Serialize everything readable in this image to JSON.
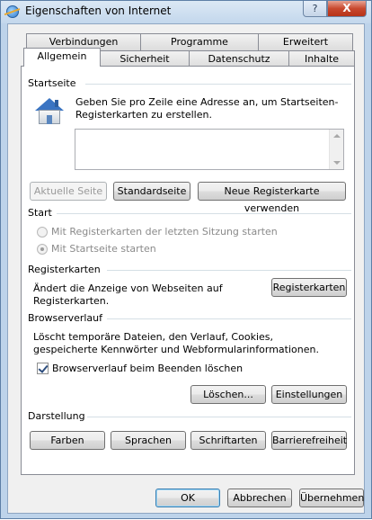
{
  "window": {
    "title": "Eigenschaften von Internet",
    "help_label": "?",
    "close_label": "X",
    "icon": "internet-options-icon"
  },
  "tabs": {
    "row1": [
      "Verbindungen",
      "Programme",
      "Erweitert"
    ],
    "row2": [
      "Allgemein",
      "Sicherheit",
      "Datenschutz",
      "Inhalte"
    ],
    "active": "Allgemein"
  },
  "startseite": {
    "title": "Startseite",
    "description": "Geben Sie pro Zeile eine Adresse an, um Startseiten-Registerkarten zu erstellen.",
    "urls_value": "",
    "icon": "house-icon",
    "btn_current": "Aktuelle Seite",
    "btn_default": "Standardseite",
    "btn_new_tab": "Neue Registerkarte verwenden"
  },
  "start": {
    "title": "Start",
    "option_last_session": "Mit Registerkarten der letzten Sitzung starten",
    "option_home": "Mit Startseite starten",
    "selected": "option_home"
  },
  "registerkarten": {
    "title": "Registerkarten",
    "description": "Ändert die Anzeige von Webseiten auf Registerkarten.",
    "button": "Registerkarten"
  },
  "browserverlauf": {
    "title": "Browserverlauf",
    "description": "Löscht temporäre Dateien, den Verlauf, Cookies, gespeicherte Kennwörter und Webformularinformationen.",
    "checkbox_label": "Browserverlauf beim Beenden löschen",
    "checkbox_checked": true,
    "btn_delete": "Löschen...",
    "btn_settings": "Einstellungen"
  },
  "darstellung": {
    "title": "Darstellung",
    "btn_colors": "Farben",
    "btn_languages": "Sprachen",
    "btn_fonts": "Schriftarten",
    "btn_accessibility": "Barrierefreiheit"
  },
  "footer": {
    "ok": "OK",
    "cancel": "Abbrechen",
    "apply": "Übernehmen"
  }
}
